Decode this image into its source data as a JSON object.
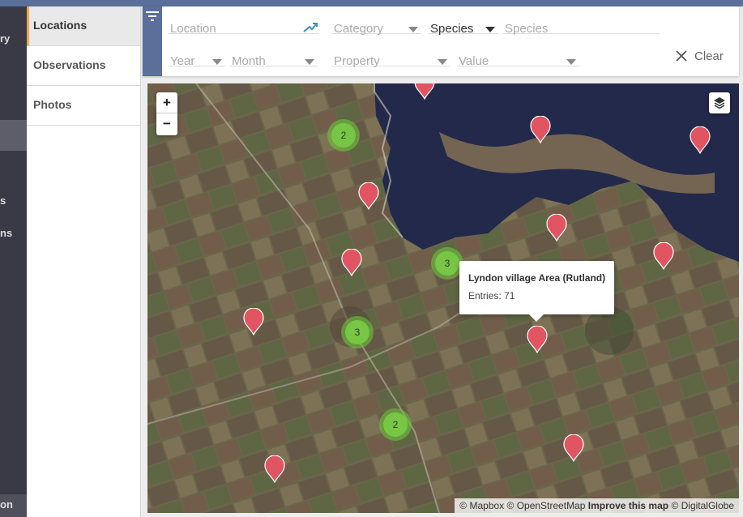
{
  "leftnav": {
    "items": [
      "ry",
      "s",
      "ns",
      "on"
    ]
  },
  "tabs": [
    {
      "label": "Locations",
      "active": true
    },
    {
      "label": "Observations",
      "active": false
    },
    {
      "label": "Photos",
      "active": false
    }
  ],
  "filters": {
    "location_placeholder": "Location",
    "category_placeholder": "Category",
    "species_select": "Species",
    "species_placeholder": "Species",
    "year_placeholder": "Year",
    "month_placeholder": "Month",
    "property_placeholder": "Property",
    "value_placeholder": "Value",
    "clear_label": "Clear"
  },
  "map": {
    "zoom_in": "+",
    "zoom_out": "−",
    "clusters": [
      {
        "count": "2"
      },
      {
        "count": "3"
      },
      {
        "count": "3"
      },
      {
        "count": "2"
      }
    ],
    "popup": {
      "title": "Lyndon village Area (Rutland)",
      "entries": "Entries: 71"
    },
    "attribution": {
      "mapbox": "© Mapbox",
      "osm": "© OpenStreetMap",
      "improve": "Improve this map",
      "digitalglobe": "© DigitalGlobe"
    }
  },
  "colors": {
    "accent": "#5a6f9a",
    "marker": "#e05561",
    "cluster": "#7ac846",
    "active_tab_border": "#f0a84a"
  },
  "icons": [
    "filter-icon",
    "locate-arrow-icon",
    "close-icon",
    "layers-icon",
    "map-marker-icon"
  ]
}
